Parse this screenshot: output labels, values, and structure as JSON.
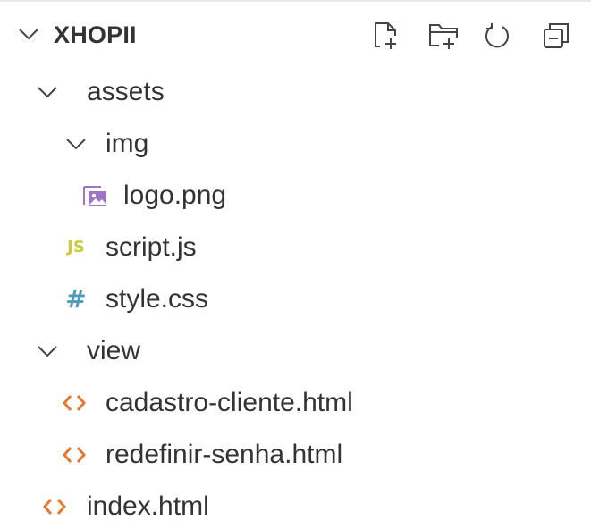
{
  "explorer": {
    "title": "XHOPII",
    "actions": [
      {
        "name": "new-file-icon"
      },
      {
        "name": "new-folder-icon"
      },
      {
        "name": "refresh-icon"
      },
      {
        "name": "collapse-all-icon"
      }
    ]
  },
  "tree": {
    "items": [
      {
        "label": "assets",
        "type": "folder"
      },
      {
        "label": "img",
        "type": "folder"
      },
      {
        "label": "logo.png",
        "type": "image-file"
      },
      {
        "label": "script.js",
        "type": "js-file",
        "icon_text": "JS"
      },
      {
        "label": "style.css",
        "type": "css-file",
        "icon_text": "#"
      },
      {
        "label": "view",
        "type": "folder"
      },
      {
        "label": "cadastro-cliente.html",
        "type": "html-file"
      },
      {
        "label": "redefinir-senha.html",
        "type": "html-file"
      },
      {
        "label": "index.html",
        "type": "html-file"
      }
    ]
  },
  "colors": {
    "image_icon": "#a074c4",
    "js_icon": "#cbcb41",
    "css_icon": "#519aba",
    "html_icon": "#e37933"
  }
}
